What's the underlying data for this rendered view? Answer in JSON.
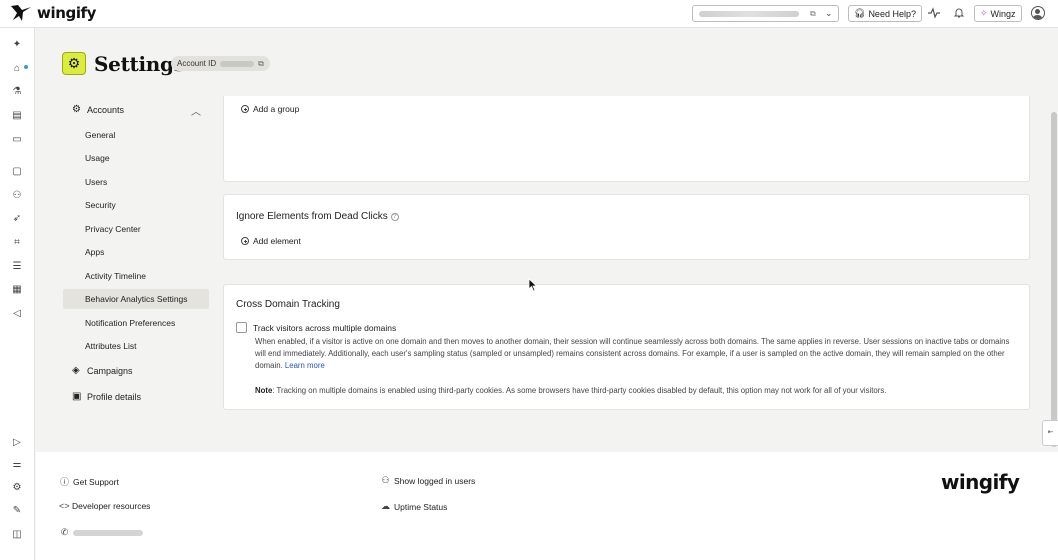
{
  "app": {
    "brand": "wingify",
    "help_label": "Need Help?",
    "wingz_label": "Wingz"
  },
  "page": {
    "title": "Settings",
    "account_id_label": "Account ID"
  },
  "sidebar": {
    "accounts_label": "Accounts",
    "items": [
      {
        "label": "General"
      },
      {
        "label": "Usage"
      },
      {
        "label": "Users"
      },
      {
        "label": "Security"
      },
      {
        "label": "Privacy Center"
      },
      {
        "label": "Apps"
      },
      {
        "label": "Activity Timeline"
      },
      {
        "label": "Behavior Analytics Settings",
        "active": true
      },
      {
        "label": "Notification Preferences"
      },
      {
        "label": "Attributes List"
      }
    ],
    "campaigns_label": "Campaigns",
    "profile_label": "Profile details"
  },
  "groups_card": {
    "add_label": "Add a group"
  },
  "dead_clicks_card": {
    "title": "Ignore Elements from Dead Clicks",
    "add_label": "Add element"
  },
  "cross_domain_card": {
    "title": "Cross Domain Tracking",
    "checkbox_label": "Track visitors across multiple domains",
    "checked": false,
    "description": "When enabled, if a visitor is active on one domain and then moves to another domain, their session will continue seamlessly across both domains. The same applies in reverse. User sessions on inactive tabs or domains will end immediately. Additionally, each user's sampling status (sampled or unsampled) remains consistent across domains. For example, if a user is sampled on the active domain, they will remain sampled on the other domain.",
    "learn_more": "Learn more",
    "note_label": "Note",
    "note_text": ": Tracking on multiple domains is enabled using third-party cookies. As some browsers have third-party cookies disabled by default, this option may not work for all of your visitors."
  },
  "footer": {
    "get_support": "Get Support",
    "developer_resources": "Developer resources",
    "show_logged_in": "Show logged in users",
    "uptime_status": "Uptime Status",
    "logo": "wingify"
  },
  "icons": {
    "rail": [
      "sparkle-icon",
      "home-icon",
      "flask-icon",
      "dashboard-icon",
      "screen-icon",
      "document-icon",
      "user-search-icon",
      "rocket-icon",
      "focus-icon",
      "server-icon",
      "calendar-icon",
      "megaphone-icon",
      "play-icon",
      "sliders-icon",
      "gear-icon",
      "brush-icon",
      "panel-icon"
    ]
  }
}
